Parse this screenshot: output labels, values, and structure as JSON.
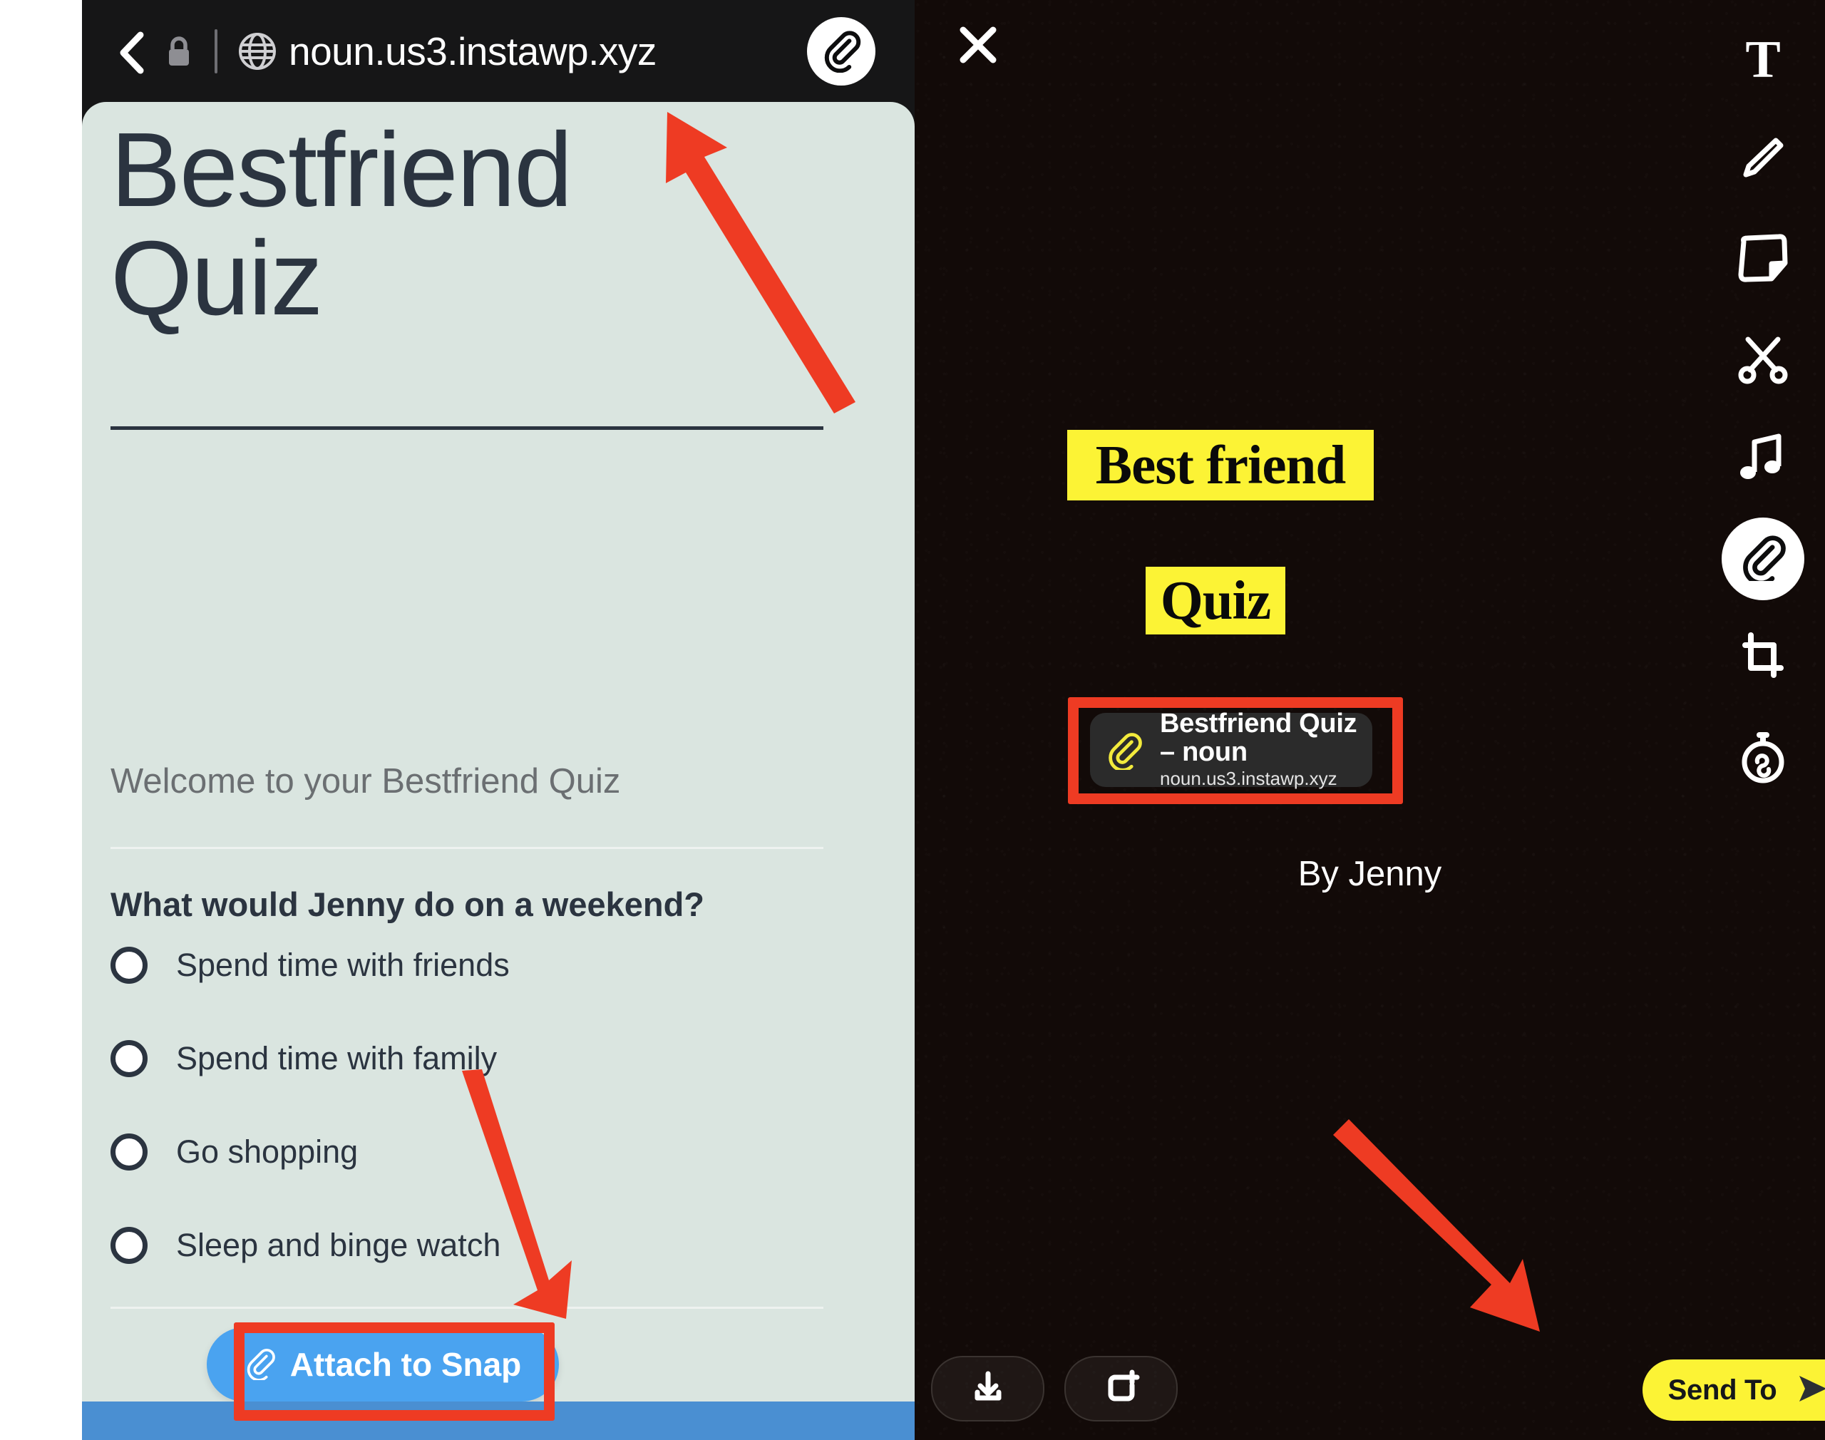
{
  "browser": {
    "url": "noun.us3.instawp.xyz",
    "back_icon": "chevron-left-icon",
    "lock_icon": "lock-icon",
    "globe_icon": "globe-icon",
    "attach_icon": "paperclip-icon"
  },
  "quiz_page": {
    "title": "Bestfriend Quiz",
    "welcome": "Welcome to your Bestfriend Quiz",
    "question": "What would Jenny do on a weekend?",
    "options": [
      "Spend time with friends",
      "Spend time with family",
      "Go shopping",
      "Sleep and binge watch"
    ],
    "attach_button_label": "Attach to Snap"
  },
  "snap_editor": {
    "close_icon": "close-icon",
    "tools": [
      {
        "name": "text-tool",
        "icon": "text-t-icon",
        "glyph": "T",
        "active": false
      },
      {
        "name": "draw-tool",
        "icon": "pencil-icon",
        "active": false
      },
      {
        "name": "sticker-tool",
        "icon": "sticker-icon",
        "active": false
      },
      {
        "name": "scissors-tool",
        "icon": "scissors-icon",
        "active": false
      },
      {
        "name": "music-tool",
        "icon": "music-note-icon",
        "active": false
      },
      {
        "name": "attachment-tool",
        "icon": "paperclip-icon",
        "active": true
      },
      {
        "name": "crop-tool",
        "icon": "crop-icon",
        "active": false
      },
      {
        "name": "timer-tool",
        "icon": "timer-infinity-icon",
        "active": false
      }
    ],
    "stickers": [
      {
        "text": "Best friend"
      },
      {
        "text": "Quiz"
      }
    ],
    "attachment_card": {
      "title": "Bestfriend Quiz – noun",
      "subtitle": "noun.us3.instawp.xyz",
      "icon": "paperclip-icon"
    },
    "caption": "By Jenny",
    "save_button_icon": "download-icon",
    "story_button_icon": "add-to-story-icon",
    "send_to_label": "Send To",
    "send_to_icon": "send-arrow-icon"
  },
  "annotations": {
    "highlight_color": "#ee3b23",
    "arrows": [
      {
        "name": "arrow-to-url-bar"
      },
      {
        "name": "arrow-to-attach-button"
      },
      {
        "name": "arrow-to-send-to-button"
      }
    ],
    "highlight_boxes": [
      {
        "name": "highlight-attach-to-snap"
      },
      {
        "name": "highlight-attachment-card"
      }
    ]
  },
  "colors": {
    "page_background": "#dae5e0",
    "browser_chrome": "#161617",
    "attach_button": "#4aa3f0",
    "sticker_yellow": "#fcf335",
    "send_to_yellow": "#fcf335",
    "annotation_red": "#ee3b23"
  }
}
